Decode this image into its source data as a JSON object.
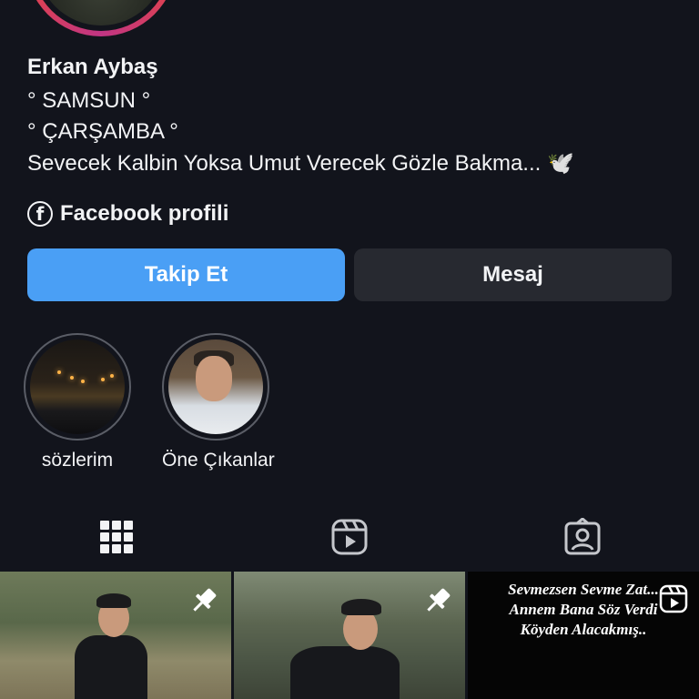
{
  "profile": {
    "name": "Erkan Aybaş",
    "bio": [
      "° SAMSUN °",
      "° ÇARŞAMBA °",
      "Sevecek Kalbin Yoksa Umut Verecek Gözle Bakma... 🕊️"
    ],
    "facebook_label": "Facebook profili"
  },
  "actions": {
    "follow_label": "Takip Et",
    "message_label": "Mesaj"
  },
  "highlights": [
    {
      "label": "sözlerim"
    },
    {
      "label": "Öne Çıkanlar"
    }
  ],
  "tabs": [
    {
      "icon": "grid-icon",
      "active": true
    },
    {
      "icon": "reels-icon",
      "active": false
    },
    {
      "icon": "tagged-icon",
      "active": false
    }
  ],
  "posts": [
    {
      "pinned": true
    },
    {
      "pinned": true
    },
    {
      "type": "reel",
      "caption": [
        "Sevmezsen  Sevme Zat...",
        "Annem Bana Söz Verdi",
        "Köyden Alacakmış.."
      ]
    }
  ],
  "colors": {
    "background": "#12141c",
    "follow_button": "#4a9ff5",
    "message_button": "#272930"
  }
}
